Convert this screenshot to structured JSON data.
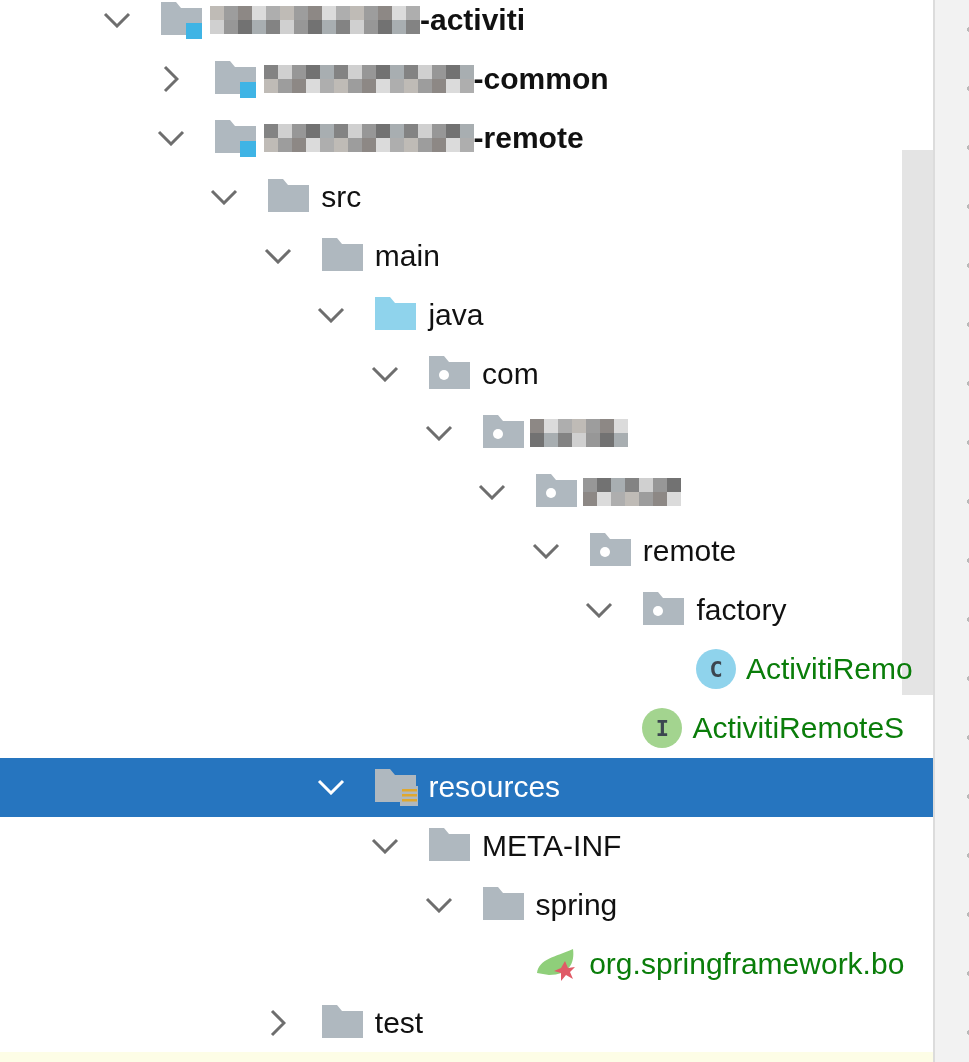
{
  "tree": [
    {
      "kind": "module",
      "redacted": true,
      "label": "-activiti",
      "expanded": true,
      "selected": false,
      "children": [
        {
          "kind": "module",
          "redacted": true,
          "label": "-common",
          "expanded": false,
          "selected": false
        },
        {
          "kind": "module",
          "redacted": true,
          "label": "-remote",
          "expanded": true,
          "selected": false,
          "children": [
            {
              "kind": "folder",
              "label": "src",
              "expanded": true,
              "selected": false,
              "children": [
                {
                  "kind": "folder",
                  "label": "main",
                  "expanded": true,
                  "selected": false,
                  "children": [
                    {
                      "kind": "source-root",
                      "label": "java",
                      "expanded": true,
                      "selected": false,
                      "children": [
                        {
                          "kind": "package",
                          "label": "com",
                          "expanded": true,
                          "selected": false,
                          "children": [
                            {
                              "kind": "package",
                              "redacted": true,
                              "expanded": true,
                              "selected": false,
                              "children": [
                                {
                                  "kind": "package",
                                  "redacted": true,
                                  "expanded": true,
                                  "selected": false,
                                  "children": [
                                    {
                                      "kind": "package",
                                      "label": "remote",
                                      "expanded": true,
                                      "selected": false,
                                      "children": [
                                        {
                                          "kind": "package",
                                          "label": "factory",
                                          "expanded": true,
                                          "selected": false,
                                          "children": [
                                            {
                                              "kind": "class",
                                              "badge": "C",
                                              "label": "ActivitiRemo",
                                              "selected": false
                                            }
                                          ]
                                        },
                                        {
                                          "kind": "interface",
                                          "badge": "I",
                                          "label": "ActivitiRemoteS",
                                          "selected": false
                                        }
                                      ]
                                    }
                                  ]
                                }
                              ]
                            }
                          ]
                        }
                      ]
                    },
                    {
                      "kind": "resources",
                      "label": "resources",
                      "expanded": true,
                      "selected": true,
                      "children": [
                        {
                          "kind": "folder",
                          "label": "META-INF",
                          "expanded": true,
                          "selected": false,
                          "children": [
                            {
                              "kind": "folder",
                              "label": "spring",
                              "expanded": true,
                              "selected": false,
                              "children": [
                                {
                                  "kind": "spring",
                                  "label": "org.springframework.bo",
                                  "selected": false
                                }
                              ]
                            }
                          ]
                        }
                      ]
                    }
                  ]
                },
                {
                  "kind": "folder",
                  "label": "test",
                  "expanded": false,
                  "selected": false
                }
              ]
            }
          ]
        }
      ]
    }
  ]
}
